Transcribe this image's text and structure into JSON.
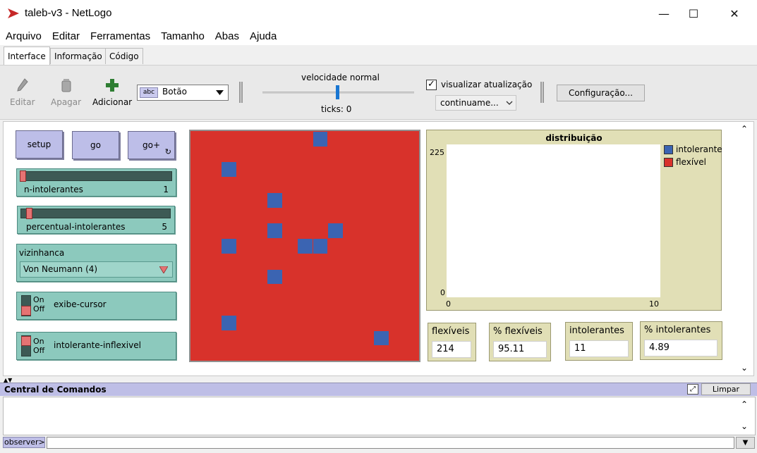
{
  "window": {
    "title": "taleb-v3 - NetLogo",
    "minimize": "—",
    "maximize": "☐",
    "close": "✕"
  },
  "menu": [
    "Arquivo",
    "Editar",
    "Ferramentas",
    "Tamanho",
    "Abas",
    "Ajuda"
  ],
  "tabs": [
    "Interface",
    "Informação",
    "Código"
  ],
  "active_tab": "Interface",
  "toolbar": {
    "edit_label": "Editar",
    "delete_label": "Apagar",
    "add_label": "Adicionar",
    "widget_type": "Botão",
    "widget_icon_text": "abc",
    "speed_label": "velocidade normal",
    "speed_fraction": 0.5,
    "ticks_label": "ticks: 0",
    "update_check_label": "visualizar atualização",
    "update_checked": true,
    "update_mode": "continuame...",
    "config_label": "Configuração..."
  },
  "buttons": {
    "setup": "setup",
    "go": "go",
    "go_plus": "go+"
  },
  "sliders": [
    {
      "name": "n-intolerantes",
      "value": "1",
      "fraction": 0.0
    },
    {
      "name": "percentual-intolerantes",
      "value": "5",
      "fraction": 0.05
    }
  ],
  "chooser": {
    "label": "vizinhanca",
    "value": "Von Neumann (4)"
  },
  "switches": [
    {
      "name": "exibe-cursor",
      "on": "On",
      "off": "Off"
    },
    {
      "name": "intolerante-inflexivel",
      "on": "On",
      "off": "Off"
    }
  ],
  "world": {
    "background": "#d8322b",
    "patch_color": "#3b64b2",
    "grid_size": [
      15,
      15
    ],
    "blue_patches": [
      [
        8,
        0
      ],
      [
        2,
        2
      ],
      [
        5,
        4
      ],
      [
        5,
        6
      ],
      [
        9,
        6
      ],
      [
        2,
        7
      ],
      [
        7,
        7
      ],
      [
        8,
        7
      ],
      [
        5,
        9
      ],
      [
        2,
        12
      ],
      [
        12,
        13
      ]
    ]
  },
  "plot": {
    "title": "distribuição",
    "y_max_label": "225",
    "y_min_label": "0",
    "x_min_label": "0",
    "x_max_label": "10",
    "legend": [
      {
        "name": "intolerante",
        "color": "#3b64b2"
      },
      {
        "name": "flexível",
        "color": "#d8322b"
      }
    ]
  },
  "chart_data": {
    "type": "line",
    "title": "distribuição",
    "xlim": [
      0,
      10
    ],
    "ylim": [
      0,
      225
    ],
    "series": [
      {
        "name": "intolerante",
        "values": []
      },
      {
        "name": "flexível",
        "values": []
      }
    ]
  },
  "monitors": [
    {
      "label": "flexíveis",
      "value": "214"
    },
    {
      "label": "% flexíveis",
      "value": "95.11"
    },
    {
      "label": "intolerantes",
      "value": "11"
    },
    {
      "label": "% intolerantes",
      "value": "4.89"
    }
  ],
  "command_center": {
    "title": "Central de Comandos",
    "clear_label": "Limpar",
    "scope": "observer>"
  }
}
